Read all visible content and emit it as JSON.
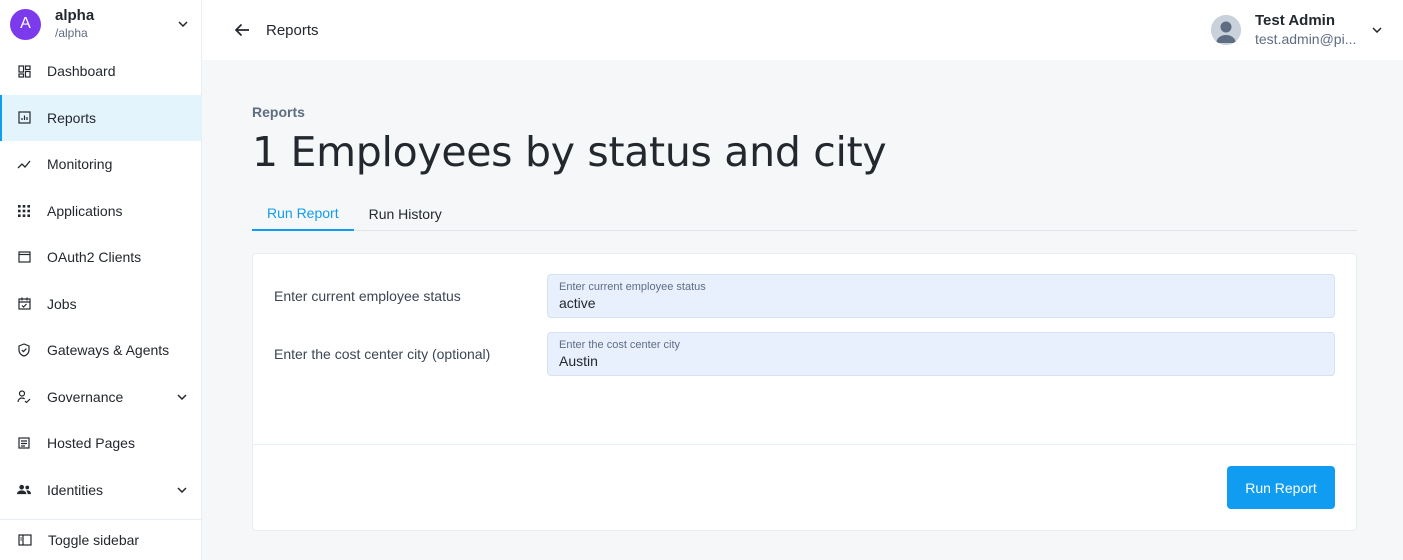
{
  "realm": {
    "initial": "A",
    "name": "alpha",
    "path": "/alpha"
  },
  "sidebar": {
    "items": [
      {
        "label": "Dashboard",
        "icon": "dashboard-icon"
      },
      {
        "label": "Reports",
        "icon": "reports-icon",
        "active": true
      },
      {
        "label": "Monitoring",
        "icon": "monitoring-icon"
      },
      {
        "label": "Applications",
        "icon": "apps-grid-icon"
      },
      {
        "label": "OAuth2 Clients",
        "icon": "window-icon"
      },
      {
        "label": "Jobs",
        "icon": "calendar-icon"
      },
      {
        "label": "Gateways & Agents",
        "icon": "shield-icon"
      },
      {
        "label": "Governance",
        "icon": "governance-icon",
        "expandable": true
      },
      {
        "label": "Hosted Pages",
        "icon": "page-icon"
      },
      {
        "label": "Identities",
        "icon": "people-icon",
        "expandable": true
      }
    ],
    "toggle_label": "Toggle sidebar"
  },
  "header": {
    "title": "Reports"
  },
  "user": {
    "name": "Test Admin",
    "email": "test.admin@pi..."
  },
  "main": {
    "breadcrumb": "Reports",
    "title": "1 Employees by status and city",
    "tabs": [
      {
        "label": "Run Report",
        "active": true
      },
      {
        "label": "Run History",
        "active": false
      }
    ],
    "form": {
      "fields": [
        {
          "label": "Enter current employee status",
          "placeholder": "Enter current employee status",
          "value": "active"
        },
        {
          "label": "Enter the cost center city (optional)",
          "placeholder": "Enter the cost center city",
          "value": "Austin"
        }
      ]
    },
    "run_button": "Run Report"
  },
  "colors": {
    "accent": "#109cf1",
    "realm_avatar": "#7c3aed",
    "field_bg": "#e8f0fe"
  }
}
